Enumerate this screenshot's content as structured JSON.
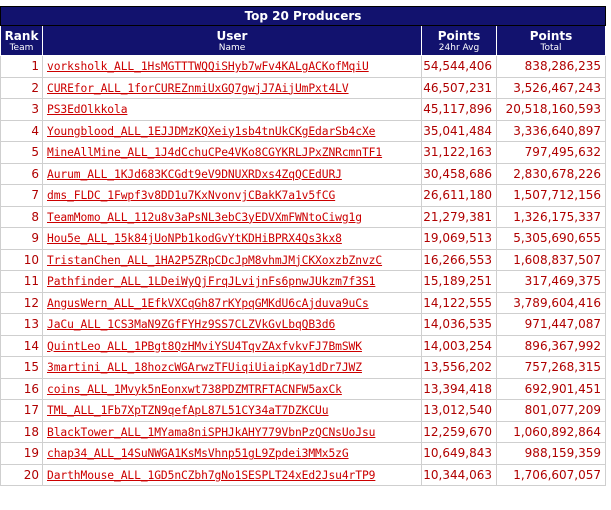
{
  "table": {
    "title": "Top 20 Producers",
    "headers": {
      "rank": {
        "label": "Rank",
        "sub": "Team"
      },
      "user": {
        "label": "User",
        "sub": "Name"
      },
      "points24": {
        "label": "Points",
        "sub": "24hr Avg"
      },
      "total": {
        "label": "Points",
        "sub": "Total"
      }
    },
    "rows": [
      {
        "rank": "1",
        "user": "vorksholk_ALL_1HsMGTTTWQQiSHyb7wFv4KALgACKofMqiU",
        "avg": "54,544,406",
        "total": "838,286,235"
      },
      {
        "rank": "2",
        "user": "CUREfor_ALL_1forCUREZnmiUxGQ7gwjJ7AijUmPxt4LV",
        "avg": "46,507,231",
        "total": "3,526,467,243"
      },
      {
        "rank": "3",
        "user": "PS3EdOlkkola",
        "avg": "45,117,896",
        "total": "20,518,160,593"
      },
      {
        "rank": "4",
        "user": "Youngblood_ALL_1EJJDMzKQXeiy1sb4tnUkCKgEdarSb4cXe",
        "avg": "35,041,484",
        "total": "3,336,640,897"
      },
      {
        "rank": "5",
        "user": "MineAllMine_ALL_1J4dCchuCPe4VKo8CGYKRLJPxZNRcmnTF1",
        "avg": "31,122,163",
        "total": "797,495,632"
      },
      {
        "rank": "6",
        "user": "Aurum_ALL_1KJd683KCGdt9eV9DNUXRDxs4ZqQCEdURJ",
        "avg": "30,458,686",
        "total": "2,830,678,226"
      },
      {
        "rank": "7",
        "user": "dms_FLDC_1Fwpf3v8DD1u7KxNvonvjCBakK7a1v5fCG",
        "avg": "26,611,180",
        "total": "1,507,712,156"
      },
      {
        "rank": "8",
        "user": "TeamMomo_ALL_112u8v3aPsNL3ebC3yEDVXmFWNtoCiwg1g",
        "avg": "21,279,381",
        "total": "1,326,175,337"
      },
      {
        "rank": "9",
        "user": "Hou5e_ALL_15k84jUoNPb1kodGvYtKDHiBPRX4Qs3kx8",
        "avg": "19,069,513",
        "total": "5,305,690,655"
      },
      {
        "rank": "10",
        "user": "TristanChen_ALL_1HA2P5ZRpCDcJpM8vhmJMjCKXoxzbZnvzC",
        "avg": "16,266,553",
        "total": "1,608,837,507"
      },
      {
        "rank": "11",
        "user": "Pathfinder_ALL_1LDeiWyQjFrqJLvijnFs6pnwJUkzm7f3S1",
        "avg": "15,189,251",
        "total": "317,469,375"
      },
      {
        "rank": "12",
        "user": "AngusWern_ALL_1EfkVXCqGh87rKYpqGMKdU6cAjduva9uCs",
        "avg": "14,122,555",
        "total": "3,789,604,416"
      },
      {
        "rank": "13",
        "user": "JaCu_ALL_1CS3MaN9ZGfFYHz9SS7CLZVkGvLbqQB3d6",
        "avg": "14,036,535",
        "total": "971,447,087"
      },
      {
        "rank": "14",
        "user": "QuintLeo_ALL_1PBgt8QzHMviYSU4TqvZAxfvkvFJ7BmSWK",
        "avg": "14,003,254",
        "total": "896,367,992"
      },
      {
        "rank": "15",
        "user": "3martini_ALL_18hozcWGArwzTFUiqiUiaipKay1dDr7JWZ",
        "avg": "13,556,202",
        "total": "757,268,315"
      },
      {
        "rank": "16",
        "user": "coins_ALL_1Mvyk5nEonxwt738PDZMTRFTACNFW5axCk",
        "avg": "13,394,418",
        "total": "692,901,451"
      },
      {
        "rank": "17",
        "user": "TML_ALL_1Fb7XpTZN9qefApL87L51CY34aT7DZKCUu",
        "avg": "13,012,540",
        "total": "801,077,209"
      },
      {
        "rank": "18",
        "user": "BlackTower_ALL_1MYama8niSPHJkAHY779VbnPzQCNsUoJsu",
        "avg": "12,259,670",
        "total": "1,060,892,864"
      },
      {
        "rank": "19",
        "user": "chap34_ALL_14SuNWGA1KsMsVhnp51gL9Zpdei3MMx5zG",
        "avg": "10,649,843",
        "total": "988,159,359"
      },
      {
        "rank": "20",
        "user": "DarthMouse_ALL_1GD5nCZbh7gNo1SESPLT24xEd2Jsu4rTP9",
        "avg": "10,344,063",
        "total": "1,706,607,057"
      }
    ]
  }
}
